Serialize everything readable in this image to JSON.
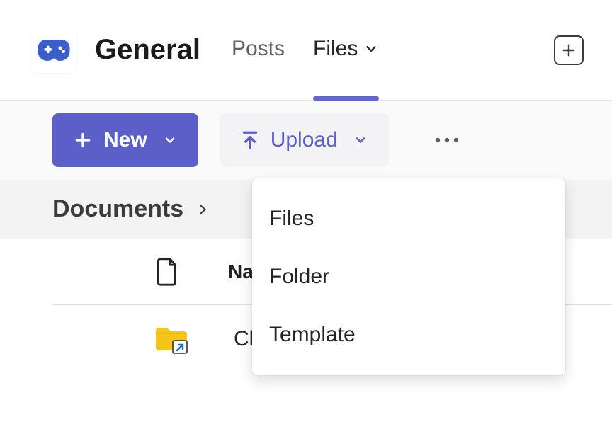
{
  "header": {
    "channel_name": "General",
    "tabs": {
      "posts": "Posts",
      "files": "Files"
    }
  },
  "toolbar": {
    "new_label": "New",
    "upload_label": "Upload"
  },
  "breadcrumb": {
    "root": "Documents"
  },
  "columns": {
    "name": "Name"
  },
  "files": {
    "item0": {
      "name": "Class Materials"
    }
  },
  "dropdown": {
    "files": "Files",
    "folder": "Folder",
    "template": "Template"
  }
}
